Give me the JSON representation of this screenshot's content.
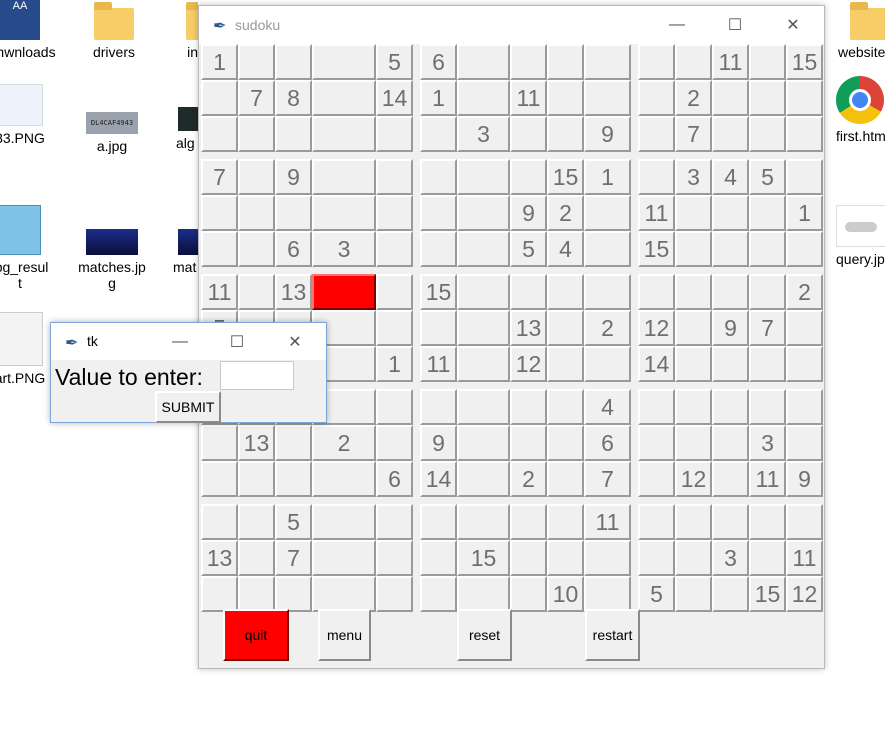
{
  "desktop": {
    "icons": [
      {
        "label": "nwnloads",
        "name": "downloads"
      },
      {
        "label": "drivers",
        "name": "drivers"
      },
      {
        "label": "in",
        "name": "in"
      },
      {
        "label": "website",
        "name": "website"
      },
      {
        "label": "33.PNG",
        "name": "png33"
      },
      {
        "label": "a.jpg",
        "name": "a-jpg"
      },
      {
        "label": "alg",
        "name": "alg"
      },
      {
        "label": "first.htm",
        "name": "first-htm"
      },
      {
        "label": "jpg_resul\nt",
        "name": "jpg-result"
      },
      {
        "label": "matches.jp\ng",
        "name": "matches-jpg"
      },
      {
        "label": "mat",
        "name": "mat"
      },
      {
        "label": "query.jp",
        "name": "query-jpg"
      },
      {
        "label": "art.PNG",
        "name": "art-png"
      }
    ],
    "plate_text": "DL4CAF4943"
  },
  "sudoku_window": {
    "title": "sudoku",
    "grid": [
      [
        "1",
        "",
        "",
        "",
        "5",
        "6",
        "",
        "",
        "",
        "",
        "",
        "",
        "11",
        "",
        "15"
      ],
      [
        "",
        "7",
        "8",
        "",
        "14",
        "1",
        "",
        "11",
        "",
        "",
        "",
        "2",
        "",
        "",
        ""
      ],
      [
        "",
        "",
        "",
        "",
        "",
        "",
        "3",
        "",
        "",
        "9",
        "",
        "7",
        "",
        "",
        ""
      ],
      [
        "7",
        "",
        "9",
        "",
        "",
        "",
        "",
        "",
        "15",
        "1",
        "",
        "3",
        "4",
        "5",
        ""
      ],
      [
        "",
        "",
        "",
        "",
        "",
        "",
        "",
        "9",
        "2",
        "",
        "11",
        "",
        "",
        "",
        "1"
      ],
      [
        "",
        "",
        "6",
        "3",
        "",
        "",
        "",
        "5",
        "4",
        "",
        "15",
        "",
        "",
        "",
        ""
      ],
      [
        "11",
        "",
        "13",
        "",
        "",
        "15",
        "",
        "",
        "",
        "",
        "",
        "",
        "",
        "",
        "2"
      ],
      [
        "5",
        "",
        "",
        "",
        "",
        "",
        "",
        "13",
        "",
        "2",
        "12",
        "",
        "9",
        "7",
        ""
      ],
      [
        "",
        "",
        "",
        "",
        "1",
        "11",
        "",
        "12",
        "",
        "",
        "14",
        "",
        "",
        "",
        ""
      ],
      [
        "",
        "",
        "",
        "",
        "",
        "",
        "",
        "",
        "",
        "4",
        "",
        "",
        "",
        "",
        ""
      ],
      [
        "",
        "13",
        "",
        "2",
        "",
        "9",
        "",
        "",
        "",
        "6",
        "",
        "",
        "",
        "3",
        ""
      ],
      [
        "",
        "",
        "",
        "",
        "6",
        "14",
        "",
        "2",
        "",
        "7",
        "",
        "12",
        "",
        "11",
        "9"
      ],
      [
        "",
        "",
        "5",
        "",
        "",
        "",
        "",
        "",
        "",
        "11",
        "",
        "",
        "",
        "",
        ""
      ],
      [
        "13",
        "",
        "7",
        "",
        "",
        "",
        "15",
        "",
        "",
        "",
        "",
        "",
        "3",
        "",
        "11"
      ],
      [
        "",
        "",
        "",
        "",
        "",
        "",
        "",
        "",
        "10",
        "",
        "5",
        "",
        "",
        "15",
        "12"
      ]
    ],
    "selected_cell": {
      "row": 6,
      "col": 3
    },
    "buttons": {
      "quit": "quit",
      "menu": "menu",
      "reset": "reset",
      "restart": "restart"
    },
    "colors": {
      "selected": "#ff0000",
      "quit": "#ff0000"
    }
  },
  "tk_window": {
    "title": "tk",
    "label": "Value to enter:",
    "entry_value": "",
    "submit": "SUBMIT"
  },
  "window_controls": {
    "minimize": "—",
    "maximize": "☐",
    "close": "✕"
  }
}
